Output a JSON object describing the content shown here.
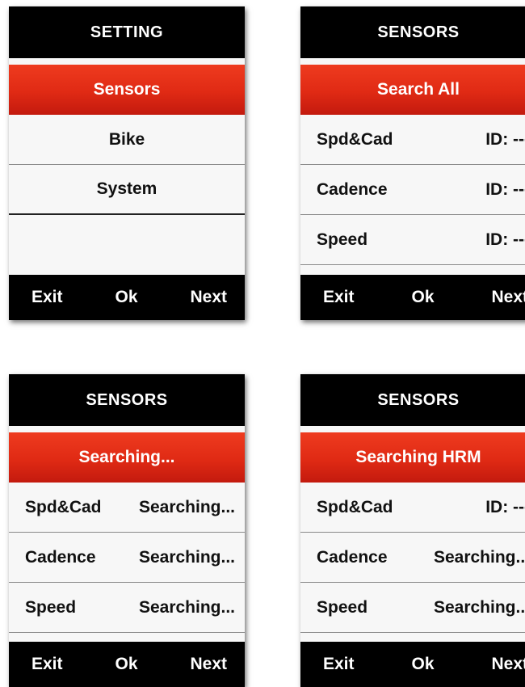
{
  "screens": [
    {
      "header": "SETTING",
      "highlight": "Sensors",
      "rows": [
        "Bike",
        "System"
      ],
      "footer": {
        "exit": "Exit",
        "ok": "Ok",
        "next": "Next"
      }
    },
    {
      "header": "SENSORS",
      "highlight": "Search All",
      "rows": [
        {
          "label": "Spd&Cad",
          "value": "ID: ---"
        },
        {
          "label": "Cadence",
          "value": "ID: ---"
        },
        {
          "label": "Speed",
          "value": "ID: ---"
        }
      ],
      "footer": {
        "exit": "Exit",
        "ok": "Ok",
        "next": "Next"
      }
    },
    {
      "header": "SENSORS",
      "highlight": "Searching...",
      "rows": [
        {
          "label": "Spd&Cad",
          "value": "Searching..."
        },
        {
          "label": "Cadence",
          "value": "Searching..."
        },
        {
          "label": "Speed",
          "value": "Searching..."
        }
      ],
      "footer": {
        "exit": "Exit",
        "ok": "Ok",
        "next": "Next"
      }
    },
    {
      "header": "SENSORS",
      "highlight": "Searching HRM",
      "rows": [
        {
          "label": "Spd&Cad",
          "value": "ID: ---"
        },
        {
          "label": "Cadence",
          "value": "Searching..."
        },
        {
          "label": "Speed",
          "value": "Searching..."
        }
      ],
      "footer": {
        "exit": "Exit",
        "ok": "Ok",
        "next": "Next"
      }
    }
  ],
  "colors": {
    "header_bg": "#000000",
    "highlight": "#e02a14",
    "screen_bg": "#f7f7f7"
  }
}
